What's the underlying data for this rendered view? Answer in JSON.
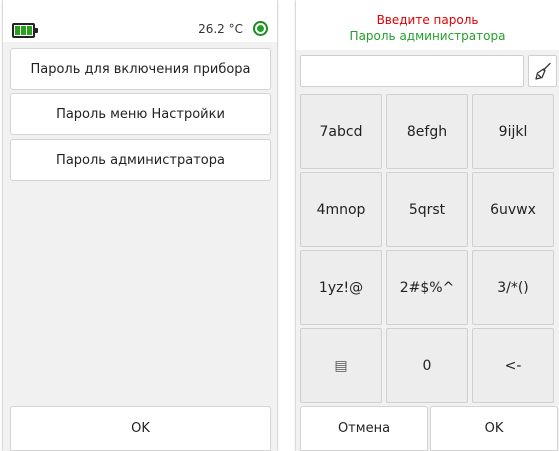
{
  "left_screen": {
    "status": {
      "temperature": "26.2 °C",
      "battery_icon": "battery-icon",
      "status_icon": "status-indicator-icon",
      "battery_color": "#2aa01f",
      "led_color": "#23a02c"
    },
    "menu": [
      {
        "label": "Пароль для включения прибора"
      },
      {
        "label": "Пароль меню Настройки"
      },
      {
        "label": "Пароль администратора"
      }
    ],
    "ok_label": "OK"
  },
  "right_screen": {
    "title": "Введите пароль",
    "subtitle": "Пароль администратора",
    "title_color": "#e00000",
    "subtitle_color": "#23a02c",
    "password_value": "",
    "clear_icon": "broom-icon",
    "keypad": [
      {
        "label": "7abcd"
      },
      {
        "label": "8efgh"
      },
      {
        "label": "9ijkl"
      },
      {
        "label": "4mnop"
      },
      {
        "label": "5qrst"
      },
      {
        "label": "6uvwx"
      },
      {
        "label": "1yz!@"
      },
      {
        "label": "2#$%^"
      },
      {
        "label": "3/*()"
      },
      {
        "label": "▤"
      },
      {
        "label": "0"
      },
      {
        "label": "<-"
      }
    ],
    "cancel_label": "Отмена",
    "ok_label": "OK"
  }
}
